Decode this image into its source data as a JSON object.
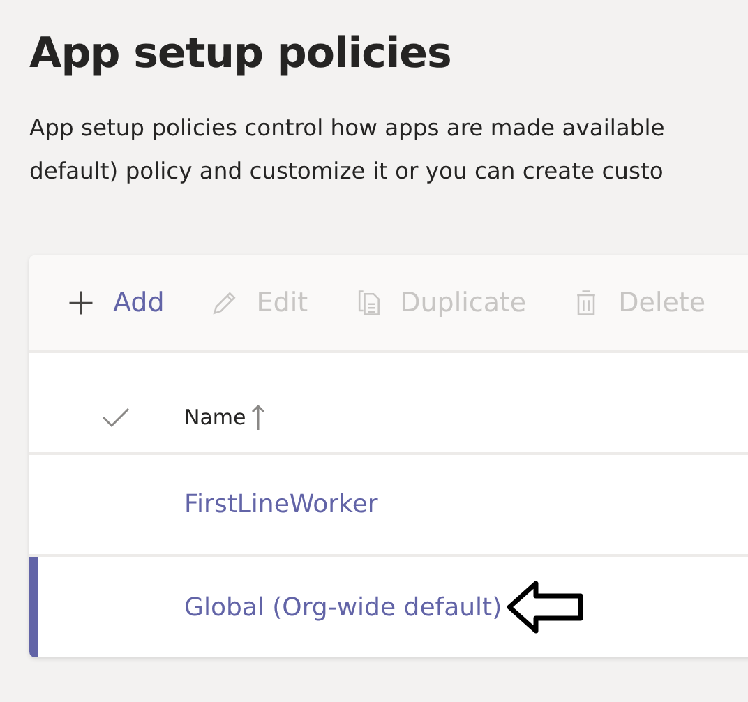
{
  "page": {
    "title": "App setup policies",
    "description_lines": [
      "App setup policies control how apps are made available",
      "default) policy and customize it or you can create custo"
    ]
  },
  "toolbar": [
    {
      "kind": "add",
      "label": "Add",
      "disabled": false
    },
    {
      "kind": "edit",
      "label": "Edit",
      "disabled": true
    },
    {
      "kind": "duplicate",
      "label": "Duplicate",
      "disabled": true
    },
    {
      "kind": "delete",
      "label": "Delete",
      "disabled": true
    }
  ],
  "table": {
    "columns": [
      {
        "label": "Name",
        "sorted": true
      }
    ],
    "rows": [
      {
        "name": "FirstLineWorker",
        "selected": false
      },
      {
        "name": "Global (Org-wide default)",
        "selected": true,
        "annotated": true
      }
    ]
  }
}
